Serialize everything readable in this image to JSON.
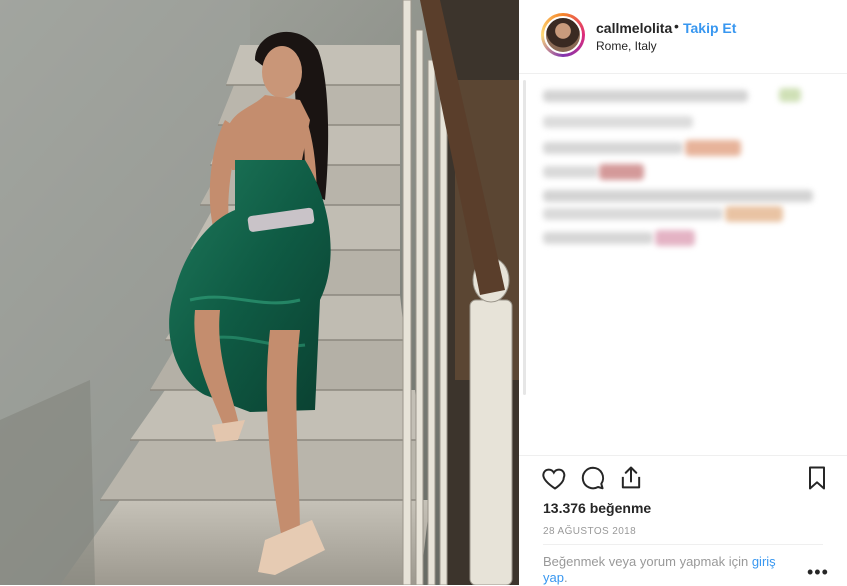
{
  "header": {
    "username": "callmelolita",
    "separator": "•",
    "follow_label": "Takip Et",
    "location": "Rome, Italy"
  },
  "post": {
    "likes": "13.376 beğenme",
    "date": "28 AĞUSTOS 2018",
    "login_prompt": "Beğenmek veya yorum yapmak için",
    "login_link": "giriş yap",
    "login_suffix": ".",
    "more": "•••"
  },
  "icons": [
    "heart-icon",
    "comment-icon",
    "share-icon",
    "bookmark-icon"
  ],
  "colors": {
    "link": "#3897f0",
    "text": "#262626",
    "muted": "#999999",
    "border": "#efefef"
  }
}
